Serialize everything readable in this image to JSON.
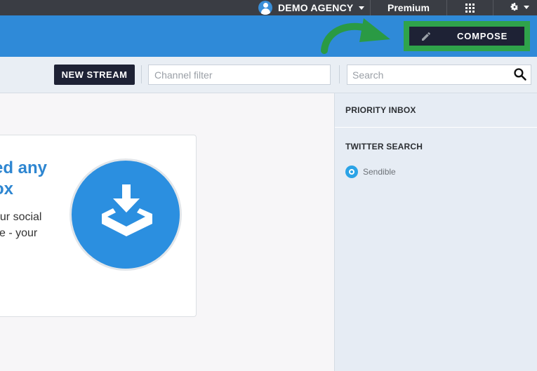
{
  "topbar": {
    "account_name": "DEMO AGENCY",
    "plan_label": "Premium"
  },
  "header": {
    "compose_label": "COMPOSE",
    "highlight_color": "#2fa34a"
  },
  "toolbar": {
    "new_stream_label": "NEW STREAM",
    "channel_filter_placeholder": "Channel filter",
    "search_placeholder": "Search"
  },
  "main": {
    "card": {
      "title_visible": "ed any\nox",
      "text_visible": "our social\nce - your"
    }
  },
  "panel": {
    "sections": [
      {
        "heading": "PRIORITY INBOX",
        "items": []
      },
      {
        "heading": "TWITTER SEARCH",
        "items": [
          {
            "label": "Sendible"
          }
        ]
      }
    ]
  },
  "colors": {
    "topbar_bg": "#3a3d44",
    "header_bg": "#2f8ad8",
    "button_dark": "#1e2235",
    "accent_blue": "#2e86d1",
    "panel_bg": "#e6ecf4"
  }
}
